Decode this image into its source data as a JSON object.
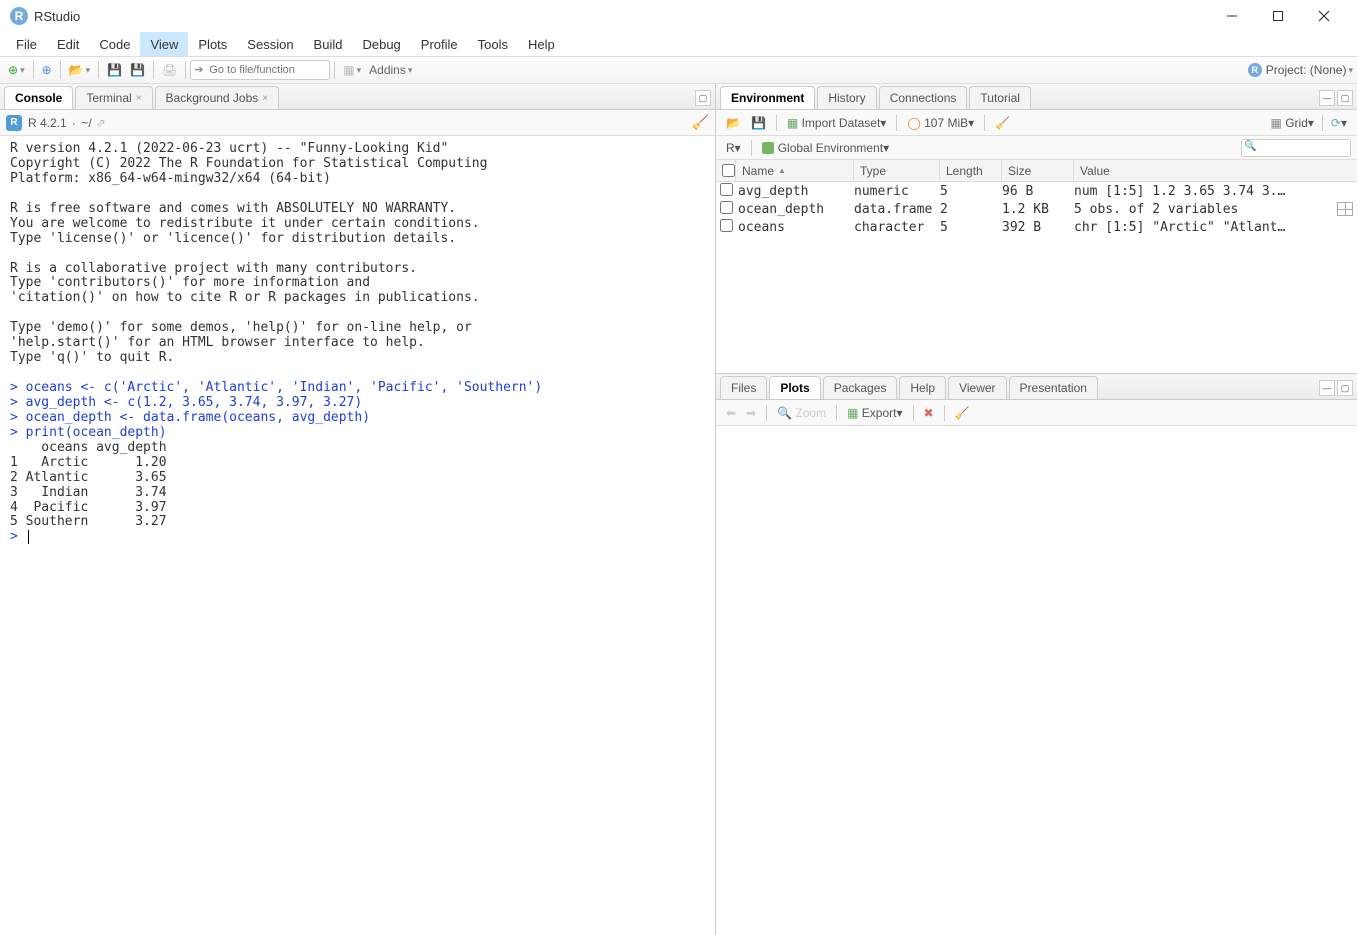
{
  "window": {
    "title": "RStudio"
  },
  "menubar": [
    "File",
    "Edit",
    "Code",
    "View",
    "Plots",
    "Session",
    "Build",
    "Debug",
    "Profile",
    "Tools",
    "Help"
  ],
  "menubar_active_index": 3,
  "toolbar": {
    "goto_placeholder": "Go to file/function",
    "addins_label": "Addins",
    "project_label": "Project: (None)"
  },
  "left": {
    "tabs": [
      {
        "label": "Console",
        "active": true,
        "closable": false
      },
      {
        "label": "Terminal",
        "active": false,
        "closable": true
      },
      {
        "label": "Background Jobs",
        "active": false,
        "closable": true
      }
    ],
    "subbar": {
      "version": "R 4.2.1",
      "path": "~/"
    },
    "console_plain_1": "R version 4.2.1 (2022-06-23 ucrt) -- \"Funny-Looking Kid\"\nCopyright (C) 2022 The R Foundation for Statistical Computing\nPlatform: x86_64-w64-mingw32/x64 (64-bit)\n\nR is free software and comes with ABSOLUTELY NO WARRANTY.\nYou are welcome to redistribute it under certain conditions.\nType 'license()' or 'licence()' for distribution details.\n\nR is a collaborative project with many contributors.\nType 'contributors()' for more information and\n'citation()' on how to cite R or R packages in publications.\n\nType 'demo()' for some demos, 'help()' for on-line help, or\n'help.start()' for an HTML browser interface to help.\nType 'q()' to quit R.\n",
    "console_cmds": "> oceans <- c('Arctic', 'Atlantic', 'Indian', 'Pacific', 'Southern')\n> avg_depth <- c(1.2, 3.65, 3.74, 3.97, 3.27)\n> ocean_depth <- data.frame(oceans, avg_depth)\n> print(ocean_depth)",
    "console_plain_2": "    oceans avg_depth\n1   Arctic      1.20\n2 Atlantic      3.65\n3   Indian      3.74\n4  Pacific      3.97\n5 Southern      3.27",
    "console_prompt": "> "
  },
  "right_upper": {
    "tabs": [
      {
        "label": "Environment",
        "active": true
      },
      {
        "label": "History",
        "active": false
      },
      {
        "label": "Connections",
        "active": false
      },
      {
        "label": "Tutorial",
        "active": false
      }
    ],
    "subbar": {
      "import_label": "Import Dataset",
      "mem_label": "107 MiB",
      "view_label": "Grid"
    },
    "scopebar": {
      "r_label": "R",
      "scope_label": "Global Environment"
    },
    "columns": [
      "Name",
      "Type",
      "Length",
      "Size",
      "Value"
    ],
    "rows": [
      {
        "name": "avg_depth",
        "type": "numeric",
        "length": "5",
        "size": "96 B",
        "value": "num [1:5] 1.2 3.65 3.74 3.…",
        "grid": false
      },
      {
        "name": "ocean_depth",
        "type": "data.frame",
        "length": "2",
        "size": "1.2 KB",
        "value": "5 obs. of 2 variables",
        "grid": true
      },
      {
        "name": "oceans",
        "type": "character",
        "length": "5",
        "size": "392 B",
        "value": "chr [1:5] \"Arctic\" \"Atlant…",
        "grid": false
      }
    ]
  },
  "right_lower": {
    "tabs": [
      {
        "label": "Files",
        "active": false
      },
      {
        "label": "Plots",
        "active": true
      },
      {
        "label": "Packages",
        "active": false
      },
      {
        "label": "Help",
        "active": false
      },
      {
        "label": "Viewer",
        "active": false
      },
      {
        "label": "Presentation",
        "active": false
      }
    ],
    "subbar": {
      "zoom_label": "Zoom",
      "export_label": "Export"
    }
  },
  "chart_data": {
    "type": "table",
    "title": "ocean_depth data.frame printed in R console",
    "columns": [
      "oceans",
      "avg_depth"
    ],
    "rows": [
      {
        "oceans": "Arctic",
        "avg_depth": 1.2
      },
      {
        "oceans": "Atlantic",
        "avg_depth": 3.65
      },
      {
        "oceans": "Indian",
        "avg_depth": 3.74
      },
      {
        "oceans": "Pacific",
        "avg_depth": 3.97
      },
      {
        "oceans": "Southern",
        "avg_depth": 3.27
      }
    ]
  }
}
